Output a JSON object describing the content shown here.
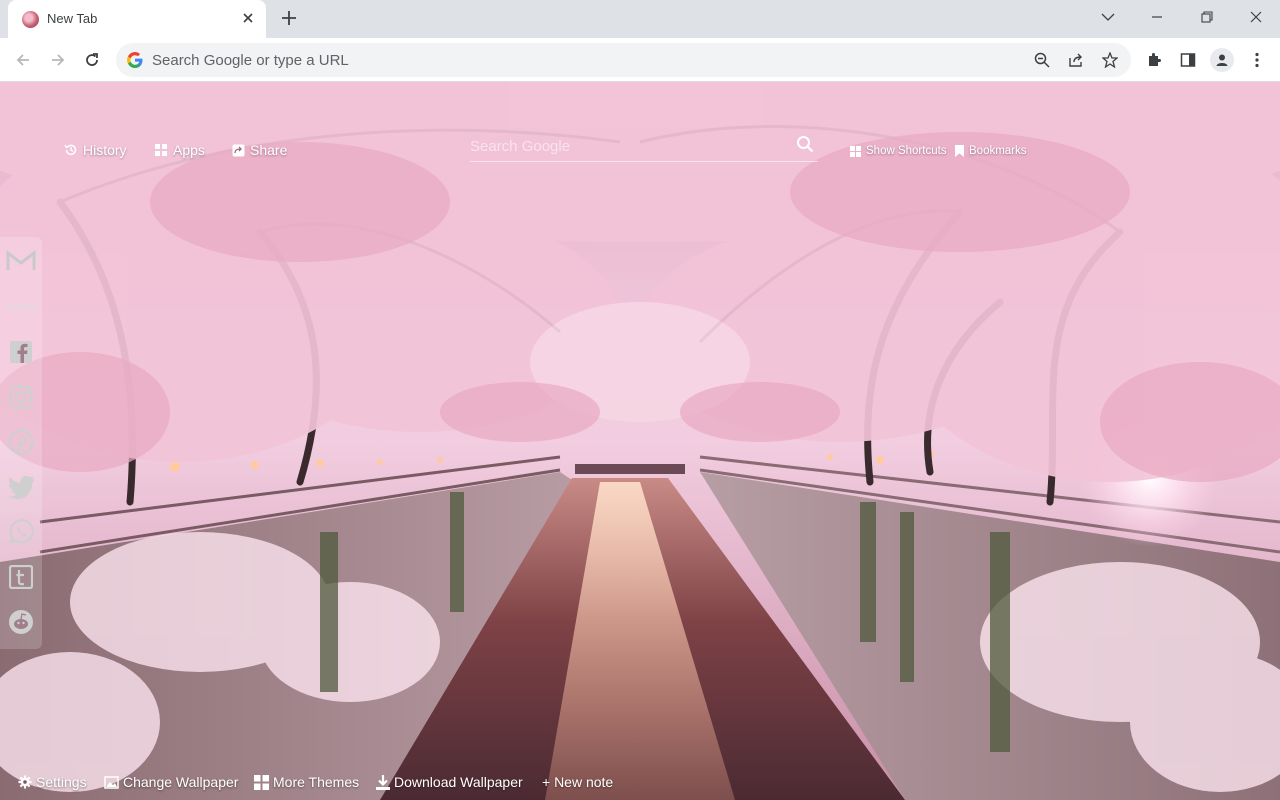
{
  "tab": {
    "title": "New Tab"
  },
  "omnibox": {
    "placeholder": "Search Google or type a URL"
  },
  "page": {
    "top_links": {
      "history": "History",
      "apps": "Apps",
      "share": "Share",
      "show_shortcuts": "Show Shortcuts",
      "bookmarks": "Bookmarks"
    },
    "search": {
      "placeholder": "Search Google"
    },
    "social": [
      "gmail-icon",
      "youtube-icon",
      "facebook-icon",
      "instagram-icon",
      "pinterest-icon",
      "twitter-icon",
      "whatsapp-icon",
      "tumblr-icon",
      "reddit-icon"
    ],
    "youtube_label": "YouTube",
    "bottom_links": {
      "settings": "Settings",
      "change_wallpaper": "Change Wallpaper",
      "more_themes": "More Themes",
      "download_wallpaper": "Download Wallpaper",
      "new_note": "+ New note"
    }
  },
  "colors": {
    "tabstrip": "#dee1e6",
    "toolbar": "#ffffff",
    "omnibox": "#f1f3f4",
    "blossom": "#f4c9da",
    "canal": "#6a3a3f"
  }
}
